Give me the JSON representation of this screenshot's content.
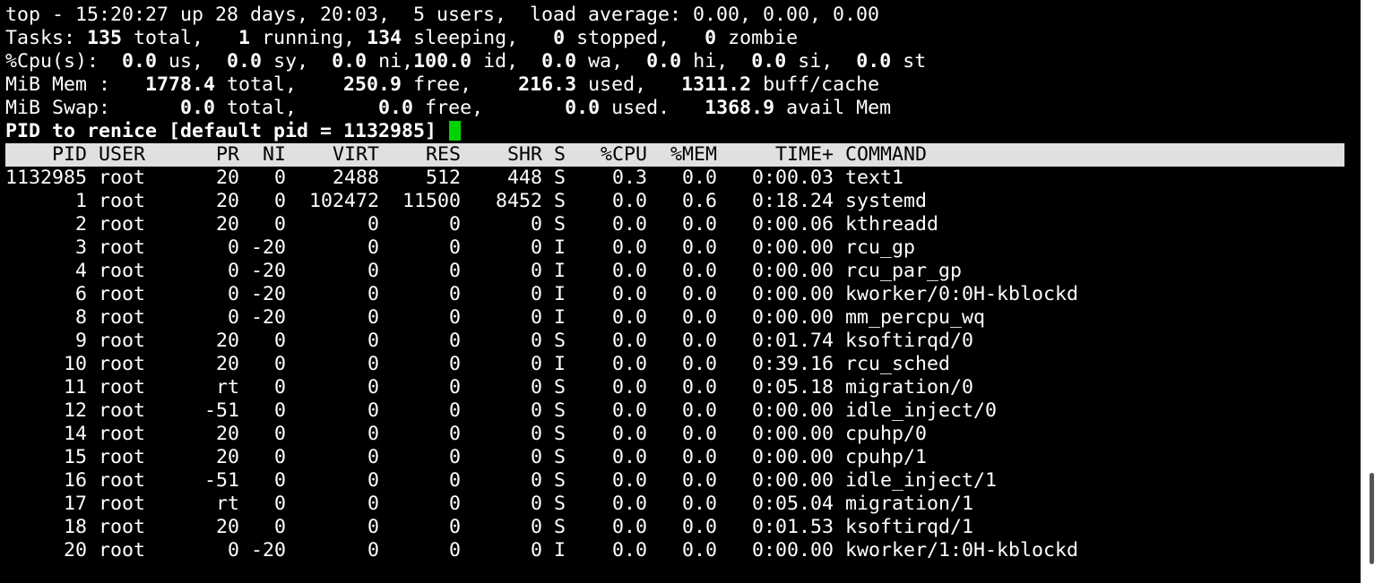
{
  "summary": {
    "line1": "top - 15:20:27 up 28 days, 20:03,  5 users,  load average: 0.00, 0.00, 0.00",
    "tasks": {
      "label": "Tasks: ",
      "total": "135",
      "total_label": " total,   ",
      "running": "1",
      "running_label": " running, ",
      "sleeping": "134",
      "sleeping_label": " sleeping,   ",
      "stopped": "0",
      "stopped_label": " stopped,   ",
      "zombie": "0",
      "zombie_label": " zombie"
    },
    "cpu": {
      "label": "%Cpu(s):  ",
      "us": "0.0",
      "us_label": " us,  ",
      "sy": "0.0",
      "sy_label": " sy,  ",
      "ni": "0.0",
      "ni_label": " ni,",
      "id": "100.0",
      "id_label": " id,  ",
      "wa": "0.0",
      "wa_label": " wa,  ",
      "hi": "0.0",
      "hi_label": " hi,  ",
      "si": "0.0",
      "si_label": " si,  ",
      "st": "0.0",
      "st_label": " st"
    },
    "mem": {
      "label": "MiB Mem :   ",
      "total": "1778.4",
      "total_label": " total,    ",
      "free": "250.9",
      "free_label": " free,    ",
      "used": "216.3",
      "used_label": " used,   ",
      "buff": "1311.2",
      "buff_label": " buff/cache"
    },
    "swap": {
      "label": "MiB Swap:      ",
      "total": "0.0",
      "total_label": " total,       ",
      "free": "0.0",
      "free_label": " free,       ",
      "used": "0.0",
      "used_label": " used.   ",
      "avail": "1368.9",
      "avail_label": " avail Mem"
    },
    "prompt": "PID to renice [default pid = 1132985] "
  },
  "table": {
    "headers": [
      "PID",
      "USER",
      "PR",
      "NI",
      "VIRT",
      "RES",
      "SHR",
      "S",
      "%CPU",
      "%MEM",
      "TIME+",
      "COMMAND"
    ],
    "rows": [
      [
        "1132985",
        "root",
        "20",
        "0",
        "2488",
        "512",
        "448",
        "S",
        "0.3",
        "0.0",
        "0:00.03",
        "text1"
      ],
      [
        "1",
        "root",
        "20",
        "0",
        "102472",
        "11500",
        "8452",
        "S",
        "0.0",
        "0.6",
        "0:18.24",
        "systemd"
      ],
      [
        "2",
        "root",
        "20",
        "0",
        "0",
        "0",
        "0",
        "S",
        "0.0",
        "0.0",
        "0:00.06",
        "kthreadd"
      ],
      [
        "3",
        "root",
        "0",
        "-20",
        "0",
        "0",
        "0",
        "I",
        "0.0",
        "0.0",
        "0:00.00",
        "rcu_gp"
      ],
      [
        "4",
        "root",
        "0",
        "-20",
        "0",
        "0",
        "0",
        "I",
        "0.0",
        "0.0",
        "0:00.00",
        "rcu_par_gp"
      ],
      [
        "6",
        "root",
        "0",
        "-20",
        "0",
        "0",
        "0",
        "I",
        "0.0",
        "0.0",
        "0:00.00",
        "kworker/0:0H-kblockd"
      ],
      [
        "8",
        "root",
        "0",
        "-20",
        "0",
        "0",
        "0",
        "I",
        "0.0",
        "0.0",
        "0:00.00",
        "mm_percpu_wq"
      ],
      [
        "9",
        "root",
        "20",
        "0",
        "0",
        "0",
        "0",
        "S",
        "0.0",
        "0.0",
        "0:01.74",
        "ksoftirqd/0"
      ],
      [
        "10",
        "root",
        "20",
        "0",
        "0",
        "0",
        "0",
        "I",
        "0.0",
        "0.0",
        "0:39.16",
        "rcu_sched"
      ],
      [
        "11",
        "root",
        "rt",
        "0",
        "0",
        "0",
        "0",
        "S",
        "0.0",
        "0.0",
        "0:05.18",
        "migration/0"
      ],
      [
        "12",
        "root",
        "-51",
        "0",
        "0",
        "0",
        "0",
        "S",
        "0.0",
        "0.0",
        "0:00.00",
        "idle_inject/0"
      ],
      [
        "14",
        "root",
        "20",
        "0",
        "0",
        "0",
        "0",
        "S",
        "0.0",
        "0.0",
        "0:00.00",
        "cpuhp/0"
      ],
      [
        "15",
        "root",
        "20",
        "0",
        "0",
        "0",
        "0",
        "S",
        "0.0",
        "0.0",
        "0:00.00",
        "cpuhp/1"
      ],
      [
        "16",
        "root",
        "-51",
        "0",
        "0",
        "0",
        "0",
        "S",
        "0.0",
        "0.0",
        "0:00.00",
        "idle_inject/1"
      ],
      [
        "17",
        "root",
        "rt",
        "0",
        "0",
        "0",
        "0",
        "S",
        "0.0",
        "0.0",
        "0:05.04",
        "migration/1"
      ],
      [
        "18",
        "root",
        "20",
        "0",
        "0",
        "0",
        "0",
        "S",
        "0.0",
        "0.0",
        "0:01.53",
        "ksoftirqd/1"
      ],
      [
        "20",
        "root",
        "0",
        "-20",
        "0",
        "0",
        "0",
        "I",
        "0.0",
        "0.0",
        "0:00.00",
        "kworker/1:0H-kblockd"
      ]
    ]
  }
}
